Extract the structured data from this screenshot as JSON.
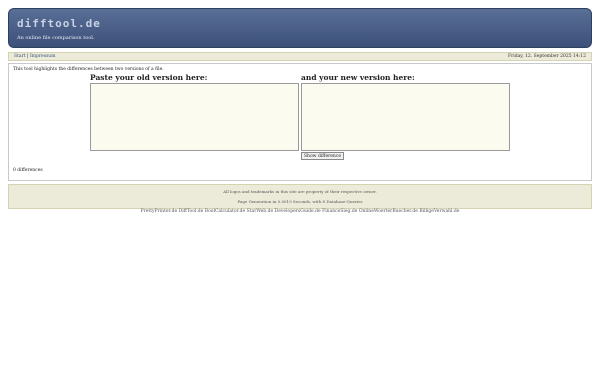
{
  "header": {
    "logo": "difftool.de",
    "tagline": "An online file comparison tool."
  },
  "nav": {
    "start": "Start",
    "separator": "|",
    "impressum": "Impressum",
    "datetime": "Friday, 12. September 2025 14:12"
  },
  "main": {
    "intro": "This tool highlights the differences between two versions of a file.",
    "old_label": "Paste your old version here:",
    "new_label": "and your new version here:",
    "old_value": "",
    "new_value": "",
    "button": "Show difference",
    "diff_count": "0 differences"
  },
  "footer": {
    "trademark": "All logos and trademarks in this site are property of their respective owner.",
    "generation": "Page Generation in 0.0019 Seconds, with 8 Database-Queries"
  },
  "sites": [
    "PrettyPrinter.de",
    "DiffTool.de",
    "BoolCalculator.de",
    "StarWeb.de",
    "DevelopersGuide.de",
    "FinanceSieg.de",
    "OnlineWoerterBuecher.de",
    "BilligeVerwahl.de"
  ]
}
